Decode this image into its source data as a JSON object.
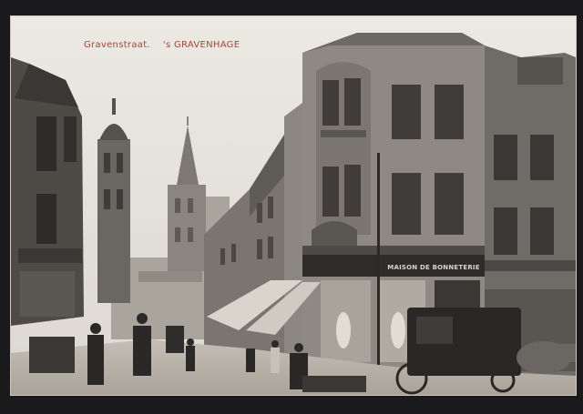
{
  "postcard": {
    "caption_street": "Gravenstraat.",
    "caption_city": "'s GRAVENHAGE",
    "caption_color": "#a0473b",
    "shop_sign": "MAISON DE BONNETERIE"
  },
  "palette": {
    "sky": "#e4e1db",
    "paper": "#e9e5de",
    "building_dark": "#4a4744",
    "building_mid": "#6e6a65",
    "building_light": "#9a958e",
    "street": "#b9b4ab"
  }
}
